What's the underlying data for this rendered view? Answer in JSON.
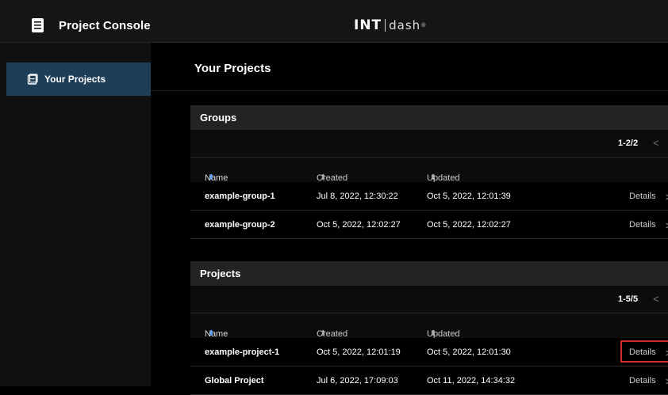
{
  "app": {
    "title": "Project Console",
    "logo_int": "INT",
    "logo_dash": "dash",
    "logo_reg": "®"
  },
  "sidebar": {
    "items": [
      {
        "label": "Your Projects",
        "icon": "folder-icon"
      }
    ]
  },
  "main": {
    "title": "Your Projects"
  },
  "groups": {
    "title": "Groups",
    "pager": "1-2/2",
    "prev_symbol": "<",
    "columns": [
      "Name",
      "Created At",
      "Updated At"
    ],
    "sort_symbol": "⬍",
    "rows": [
      {
        "name": "example-group-1",
        "created": "Jul 8, 2022, 12:30:22",
        "updated": "Oct 5, 2022, 12:01:39",
        "details": "Details",
        "chevron": ">"
      },
      {
        "name": "example-group-2",
        "created": "Oct 5, 2022, 12:02:27",
        "updated": "Oct 5, 2022, 12:02:27",
        "details": "Details",
        "chevron": ">"
      }
    ]
  },
  "projects": {
    "title": "Projects",
    "pager": "1-5/5",
    "prev_symbol": "<",
    "columns": [
      "Name",
      "Created At",
      "Updated At"
    ],
    "sort_symbol": "⬍",
    "rows": [
      {
        "name": "example-project-1",
        "created": "Oct 5, 2022, 12:01:19",
        "updated": "Oct 5, 2022, 12:01:30",
        "details": "Details",
        "chevron": ">",
        "highlighted": true
      },
      {
        "name": "Global Project",
        "created": "Jul 6, 2022, 17:09:03",
        "updated": "Oct 11, 2022, 14:34:32",
        "details": "Details",
        "chevron": ">"
      }
    ]
  },
  "colors": {
    "accent_blue": "#5aa3ff",
    "sidebar_active": "#1e3e58",
    "highlight_red": "#d62b2b"
  }
}
